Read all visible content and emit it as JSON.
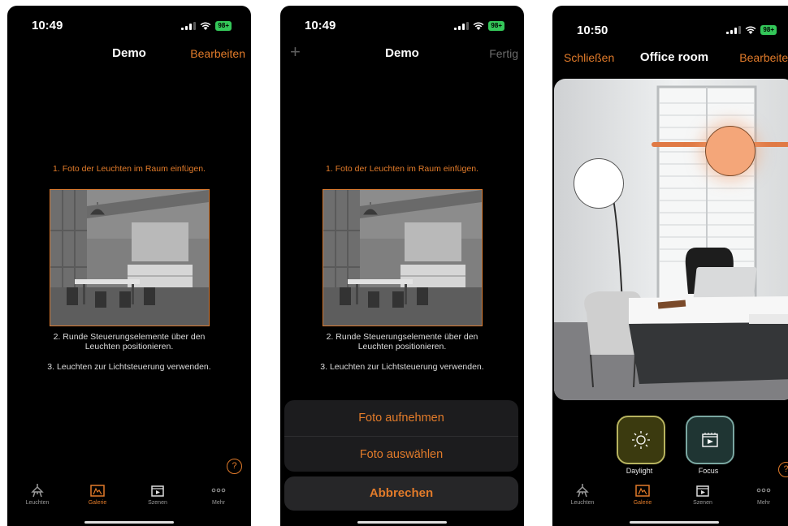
{
  "status": {
    "time1": "10:49",
    "time2": "10:49",
    "time3": "10:50",
    "battery": "98+"
  },
  "screen1": {
    "title": "Demo",
    "edit": "Bearbeiten",
    "step1": "1. Foto der Leuchten im Raum einfügen.",
    "step2": "2. Runde Steuerungselemente über den Leuchten positionieren.",
    "step3": "3. Leuchten zur Lichtsteuerung verwenden."
  },
  "screen2": {
    "title": "Demo",
    "done": "Fertig",
    "plus": "+",
    "take_photo": "Foto aufnehmen",
    "choose_photo": "Foto auswählen",
    "cancel": "Abbrechen"
  },
  "screen3": {
    "close": "Schließen",
    "title": "Office room",
    "edit": "Bearbeiten",
    "scene1": "Daylight",
    "scene2": "Focus"
  },
  "tabs": [
    "Leuchten",
    "Galerie",
    "Szenen",
    "Mehr"
  ],
  "help": "?",
  "colors": {
    "accent": "#e27b2a",
    "background": "#000000",
    "sheet": "#1c1c1e"
  }
}
